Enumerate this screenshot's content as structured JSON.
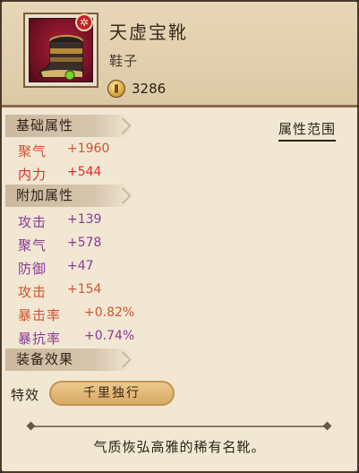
{
  "item": {
    "name": "天虚宝靴",
    "type": "鞋子",
    "price": "3286",
    "rank_badge": "✲",
    "icon": "boot-icon"
  },
  "sections": {
    "base_title": "基础属性",
    "extra_title": "附加属性",
    "effect_title": "装备效果",
    "range_button": "属性范围"
  },
  "base_attrs": [
    {
      "label": "聚气",
      "value": "+1960",
      "color": "#d2552e"
    },
    {
      "label": "内力",
      "value": "+544",
      "color": "#e02a2a"
    }
  ],
  "extra_attrs": [
    {
      "label": "攻击",
      "value": "+139",
      "color": "#8a3a96"
    },
    {
      "label": "聚气",
      "value": "+578",
      "color": "#8a3a96"
    },
    {
      "label": "防御",
      "value": "+47",
      "color": "#8a3a96"
    },
    {
      "label": "攻击",
      "value": "+154",
      "color": "#d2552e"
    },
    {
      "label": "暴击率",
      "value": "+0.82%",
      "color": "#d2552e"
    },
    {
      "label": "暴抗率",
      "value": "+0.74%",
      "color": "#8a3a96"
    }
  ],
  "effect": {
    "label": "特效",
    "skill": "千里独行"
  },
  "description": "气质恢弘高雅的稀有名靴。"
}
